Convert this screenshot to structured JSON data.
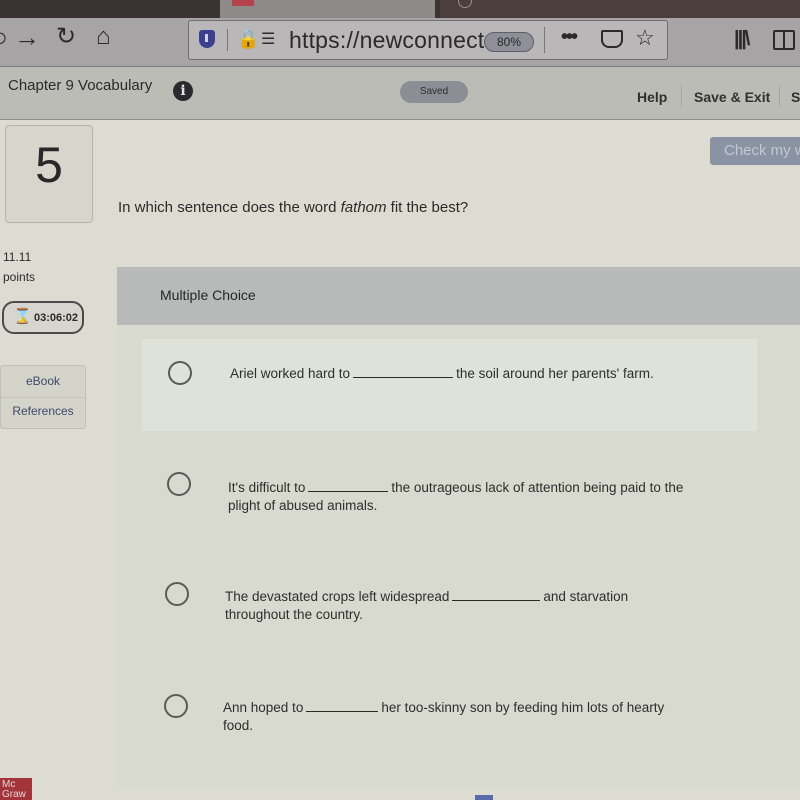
{
  "browser": {
    "url": "https://newconnect",
    "zoom_level": "80%",
    "icons": {
      "back": "back-arrow-icon",
      "forward": "forward-arrow-icon",
      "reload": "reload-icon",
      "home": "home-icon",
      "tracking": "shield-icon",
      "lock": "lock-icon",
      "permissions": "permissions-icon",
      "more": "more-icon",
      "pocket": "pocket-icon",
      "bookmark": "star-icon",
      "library": "library-icon",
      "sidebar": "sidebar-icon"
    }
  },
  "header": {
    "assignment_title": "Chapter 9 Vocabulary",
    "info_glyph": "i",
    "save_status": "Saved",
    "links": [
      "Help",
      "Save & Exit",
      "S"
    ]
  },
  "question": {
    "number": "5",
    "points_value": "11.11",
    "points_label": "points",
    "timer": "03:06:02",
    "prompt_before": "In which sentence does the word ",
    "prompt_word": "fathom",
    "prompt_after": " fit the best?",
    "check_button": "Check my w"
  },
  "side_links": [
    "eBook",
    "References"
  ],
  "multiple_choice": {
    "title": "Multiple Choice",
    "choices": [
      {
        "before": "Ariel worked hard to",
        "after": "the soil around her parents' farm."
      },
      {
        "before": "It's difficult to",
        "after": "the outrageous lack of attention being paid to the plight of abused animals."
      },
      {
        "before": "The devastated crops left widespread",
        "after": "and starvation throughout the country."
      },
      {
        "before": "Ann hoped to",
        "after": "her too-skinny son by feeding him lots of hearty food."
      }
    ]
  },
  "footer": {
    "logo_text": "Mc Graw"
  }
}
